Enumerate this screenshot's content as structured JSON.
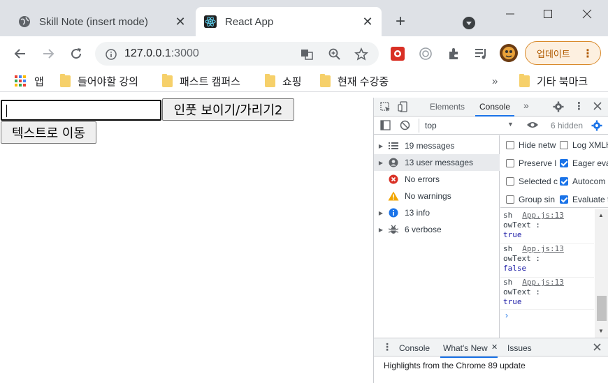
{
  "tabs": [
    {
      "title": "Skill Note (insert mode)",
      "close": "✕"
    },
    {
      "title": "React App",
      "close": "✕"
    }
  ],
  "new_tab": "+",
  "address": {
    "host": "127.0.0.1",
    "port": ":3000"
  },
  "update_button": "업데이트",
  "bookmarks": {
    "apps": "앱",
    "items": [
      "들어야할 강의",
      "패스트 캠퍼스",
      "쇼핑",
      "현재 수강중"
    ],
    "overflow": "»",
    "other": "기타 북마크"
  },
  "page": {
    "toggle_button": "인풋 보이기/가리기2",
    "move_button": "텍스트로 이동"
  },
  "devtools": {
    "tabs": {
      "elements": "Elements",
      "console": "Console",
      "more": "»"
    },
    "context": "top",
    "hidden_count": "6 hidden",
    "sidebar": [
      {
        "label": "19 messages"
      },
      {
        "label": "13 user messages"
      },
      {
        "label": "No errors"
      },
      {
        "label": "No warnings"
      },
      {
        "label": "13 info"
      },
      {
        "label": "6 verbose"
      }
    ],
    "filters_left": [
      "Hide netw",
      "Preserve l",
      "Selected c",
      "Group sin"
    ],
    "filters_right": [
      "Log XMLH",
      "Eager eva",
      "Autocom",
      "Evaluate t"
    ],
    "logs": [
      {
        "line1": "sh",
        "source": "App.js:13",
        "line2": "owText :",
        "value": "true"
      },
      {
        "line1": "sh",
        "source": "App.js:13",
        "line2": "owText :",
        "value": "false"
      },
      {
        "line1": "sh",
        "source": "App.js:13",
        "line2": "owText :",
        "value": "true"
      }
    ],
    "prompt": "›",
    "drawer_tabs": {
      "console": "Console",
      "whats_new": "What's New",
      "issues": "Issues"
    },
    "drawer_text": "Highlights from the Chrome 89 update"
  },
  "colors": {
    "accent": "#1a73e8",
    "tabstrip": "#dee1e6",
    "error": "#d93025",
    "warning": "#f2a600",
    "info": "#1a73e8"
  }
}
